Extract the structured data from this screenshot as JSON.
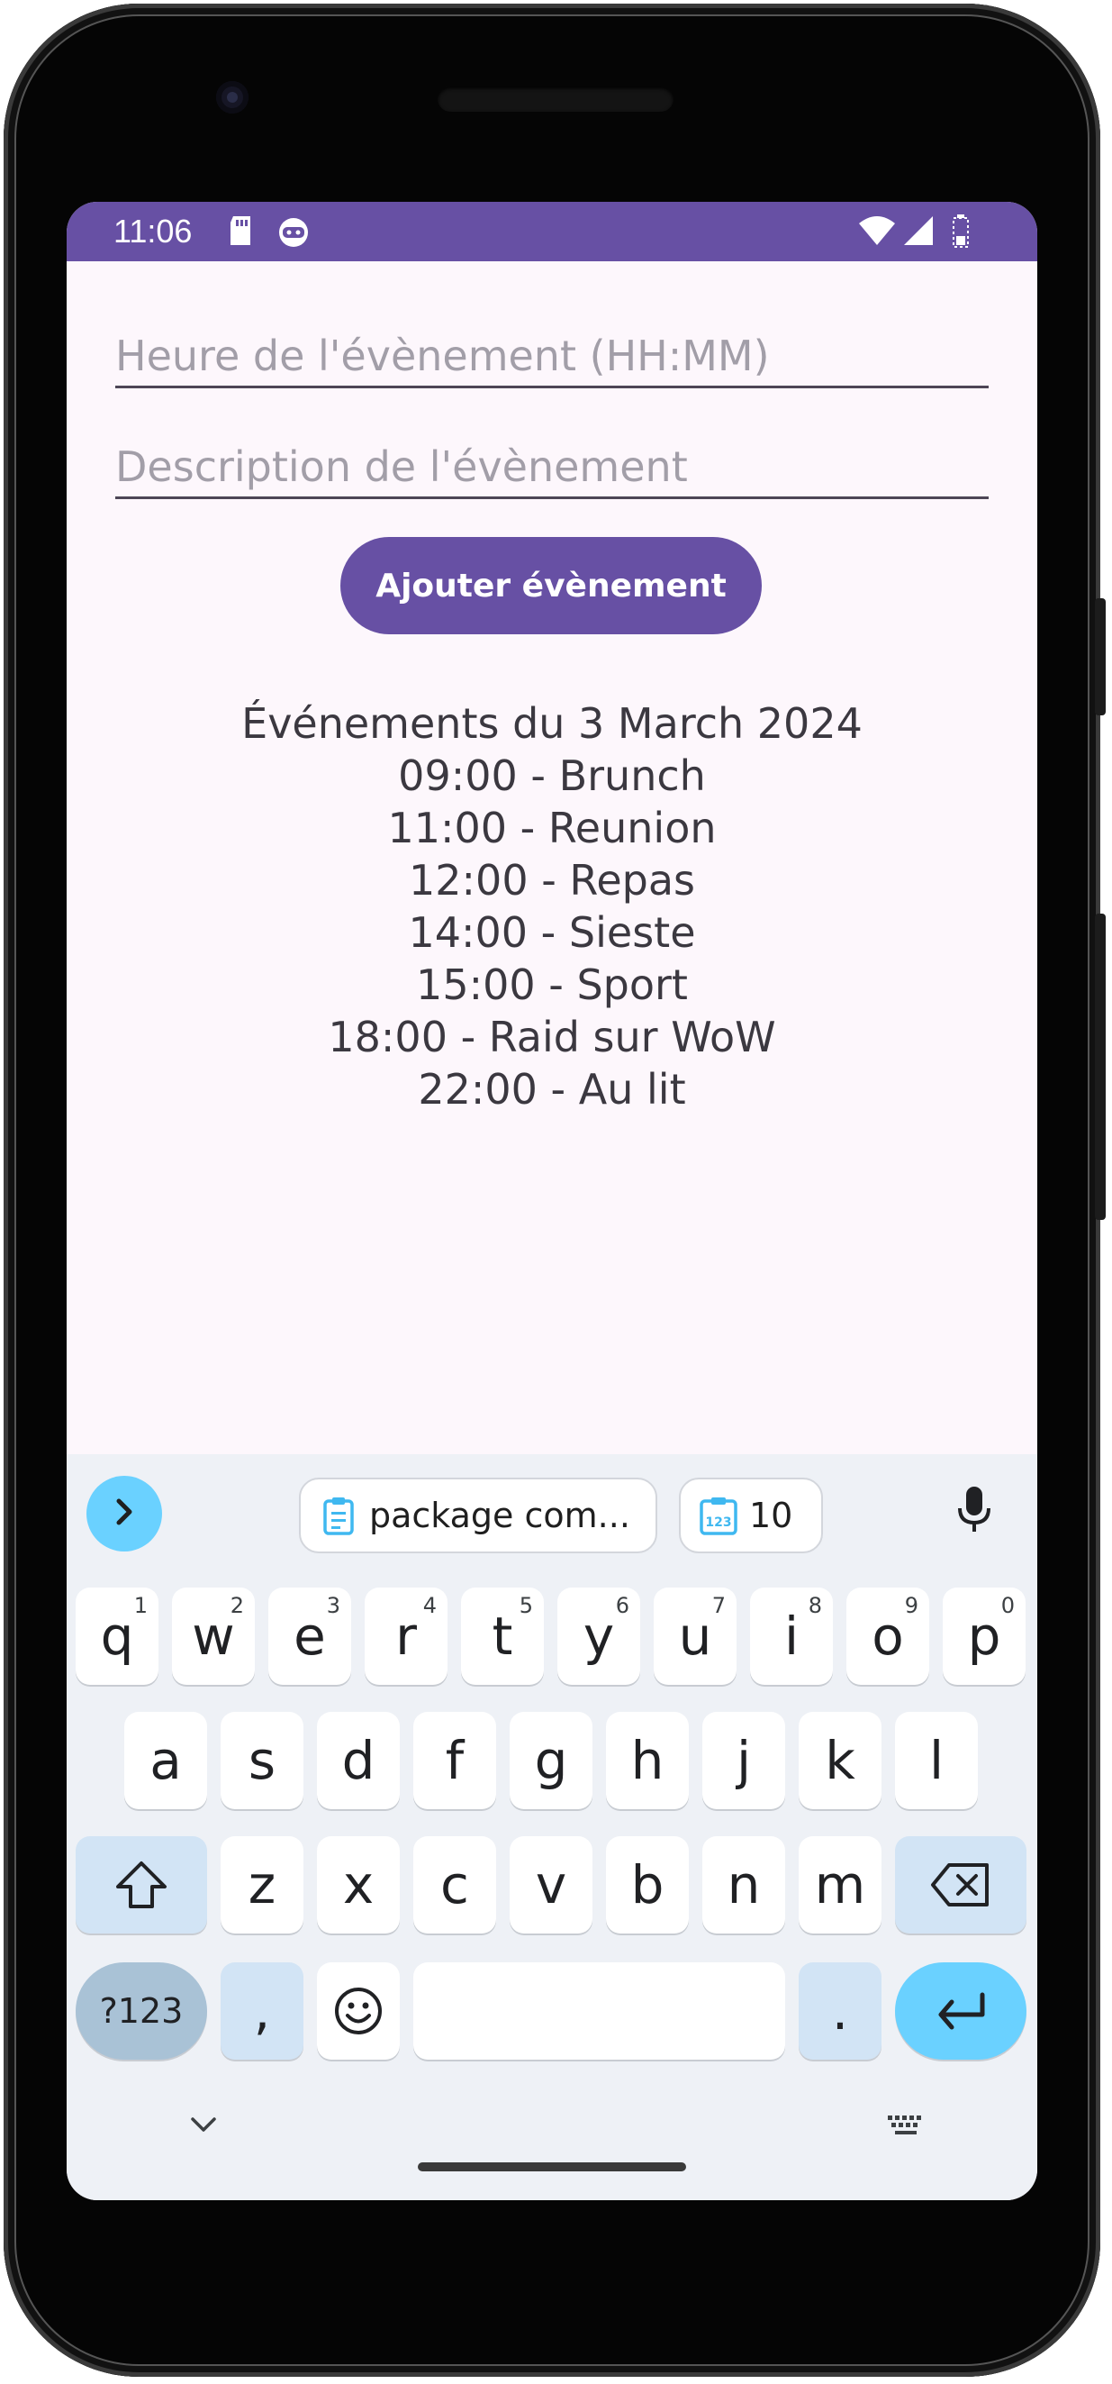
{
  "status_bar": {
    "time": "11:06",
    "icons": [
      "sd-card-icon",
      "android-debug-icon",
      "wifi-icon",
      "signal-icon",
      "battery-icon"
    ],
    "color": "#6750a4"
  },
  "form": {
    "time_placeholder": "Heure de l'évènement (HH:MM)",
    "description_placeholder": "Description de l'évènement",
    "add_button": "Ajouter évènement",
    "accent": "#6750a4"
  },
  "events": {
    "heading": "Événements du 3 March 2024",
    "items": [
      "09:00 - Brunch",
      "11:00 - Reunion",
      "12:00 - Repas",
      "14:00 - Sieste",
      "15:00 - Sport",
      "18:00 - Raid sur WoW",
      "22:00 - Au lit"
    ]
  },
  "keyboard": {
    "suggestion_clipboard": "package com...",
    "suggestion_numbers": "10",
    "row1": [
      {
        "k": "q",
        "h": "1"
      },
      {
        "k": "w",
        "h": "2"
      },
      {
        "k": "e",
        "h": "3"
      },
      {
        "k": "r",
        "h": "4"
      },
      {
        "k": "t",
        "h": "5"
      },
      {
        "k": "y",
        "h": "6"
      },
      {
        "k": "u",
        "h": "7"
      },
      {
        "k": "i",
        "h": "8"
      },
      {
        "k": "o",
        "h": "9"
      },
      {
        "k": "p",
        "h": "0"
      }
    ],
    "row2": [
      "a",
      "s",
      "d",
      "f",
      "g",
      "h",
      "j",
      "k",
      "l"
    ],
    "row3": [
      "z",
      "x",
      "c",
      "v",
      "b",
      "n",
      "m"
    ],
    "symbols_key": "?123",
    "comma_key": ",",
    "period_key": ".",
    "accent": "#6ad1ff"
  }
}
